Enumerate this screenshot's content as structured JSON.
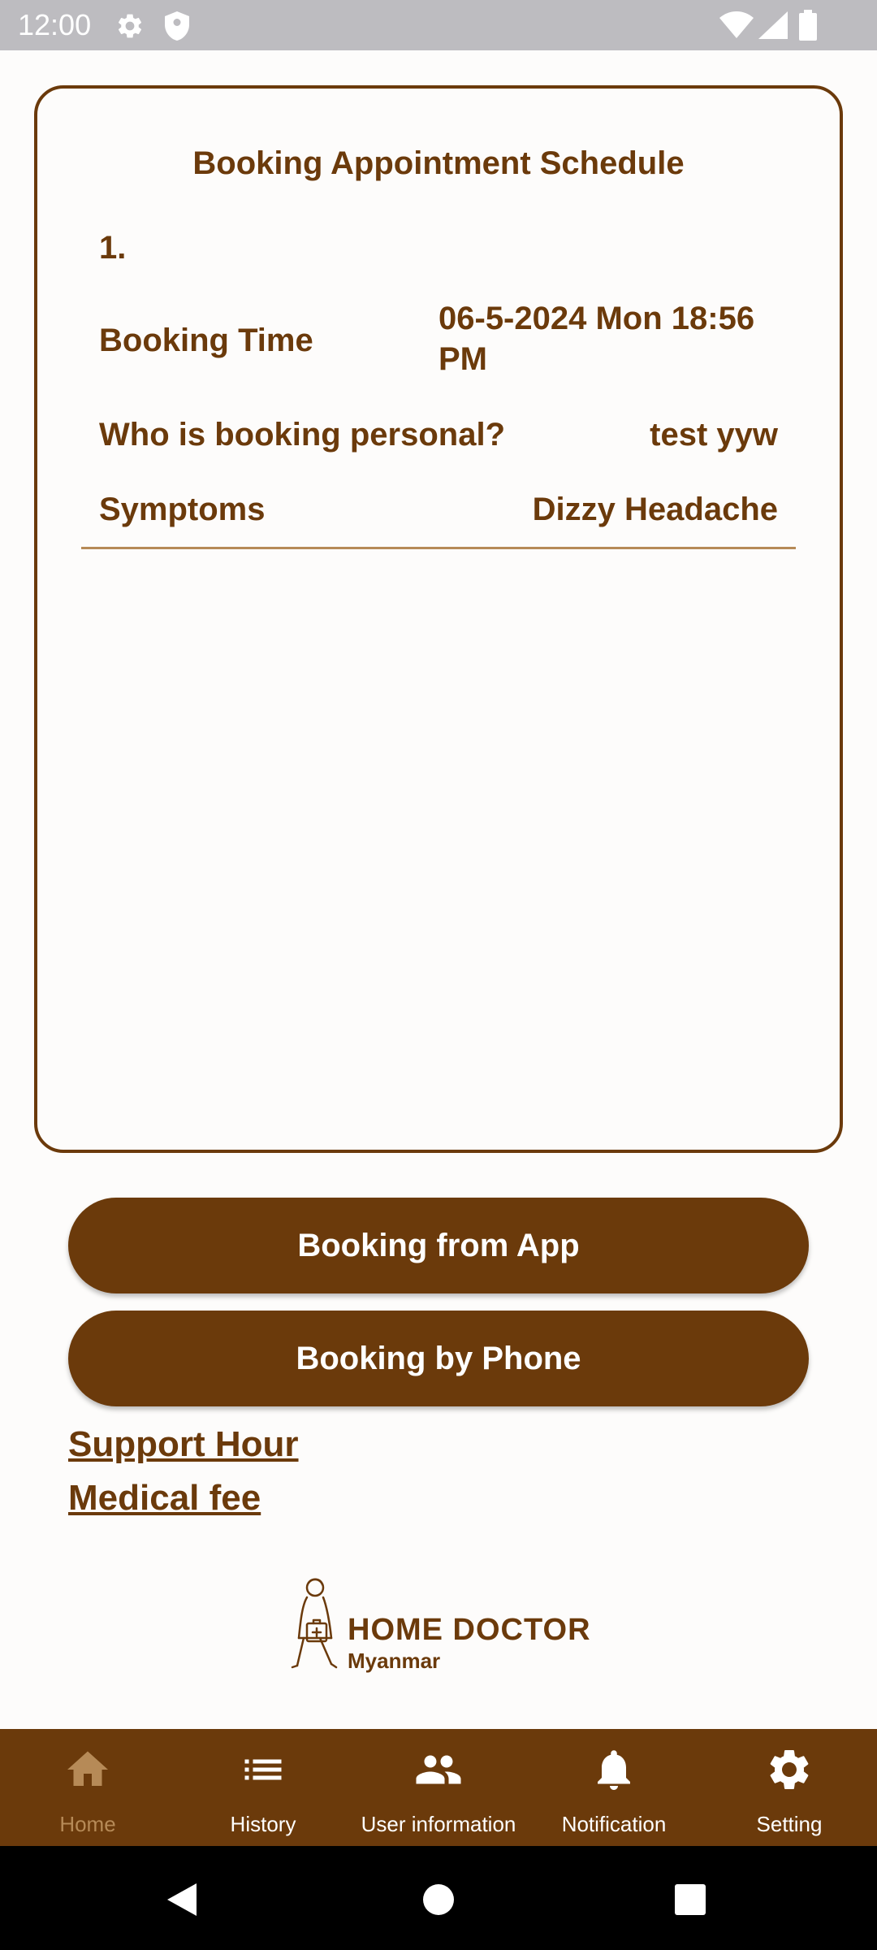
{
  "status_bar": {
    "time": "12:00",
    "icons": [
      "gear-icon",
      "shield-icon",
      "wifi-icon",
      "signal-icon",
      "battery-icon"
    ]
  },
  "card": {
    "title": "Booking Appointment Schedule",
    "entries": [
      {
        "index": "1.",
        "booking_time_label": "Booking Time",
        "booking_time_value": "06-5-2024 Mon 18:56 PM",
        "who_label": "Who is booking personal?",
        "who_value": "test yyw",
        "symptoms_label": "Symptoms",
        "symptoms_value": "Dizzy Headache"
      }
    ]
  },
  "buttons": {
    "booking_app": "Booking from App",
    "booking_phone": "Booking by Phone"
  },
  "links": {
    "support_hour": "Support Hour",
    "medical_fee": "Medical fee"
  },
  "logo": {
    "title": "HOME DOCTOR",
    "subtitle": "Myanmar"
  },
  "bottom_nav": {
    "active": "Home",
    "items": [
      {
        "label": "Home",
        "icon": "home-icon"
      },
      {
        "label": "History",
        "icon": "list-icon"
      },
      {
        "label": "User information",
        "icon": "people-icon"
      },
      {
        "label": "Notification",
        "icon": "bell-icon"
      },
      {
        "label": "Setting",
        "icon": "gear-icon"
      }
    ]
  },
  "colors": {
    "primary_brown": "#6B3A0B",
    "active_tan": "#B68A57",
    "status_bar_gray": "#BDBCC0",
    "background": "#FDFCFB"
  }
}
